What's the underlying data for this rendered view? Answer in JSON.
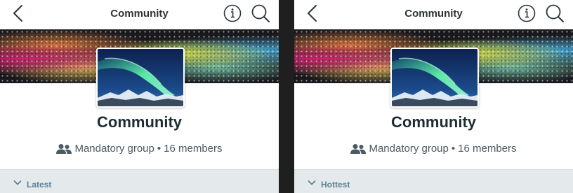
{
  "colors": {
    "background": "#1f1f1f",
    "panel": "#ffffff",
    "title_text": "#2d3439",
    "group_name_text": "#1f2d33",
    "meta_text": "#4a5b63",
    "sort_bar": "#e4e9eb",
    "sort_text": "#5a8396"
  },
  "panels": [
    {
      "header": {
        "title": "Community",
        "back_icon": "chevron-left-icon",
        "info_icon": "info-icon",
        "search_icon": "search-icon"
      },
      "group": {
        "name": "Community",
        "type": "Mandatory group",
        "separator": "•",
        "members": "16 members",
        "people_icon": "people-icon"
      },
      "sort": {
        "label": "Latest",
        "chevron_icon": "chevron-down-icon"
      }
    },
    {
      "header": {
        "title": "Community",
        "back_icon": "chevron-left-icon",
        "info_icon": "info-icon",
        "search_icon": "search-icon"
      },
      "group": {
        "name": "Community",
        "type": "Mandatory group",
        "separator": "•",
        "members": "16 members",
        "people_icon": "people-icon"
      },
      "sort": {
        "label": "Hottest",
        "chevron_icon": "chevron-down-icon"
      }
    }
  ]
}
